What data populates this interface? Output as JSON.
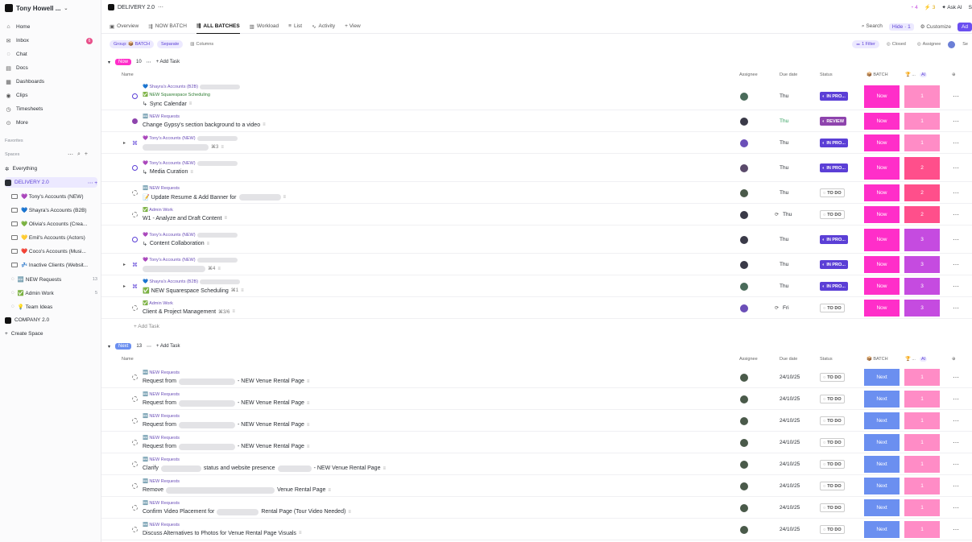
{
  "workspace": {
    "name": "Tony Howell ..."
  },
  "sidebar": {
    "nav": [
      {
        "label": "Home",
        "icon": "home-icon"
      },
      {
        "label": "Inbox",
        "icon": "inbox-icon",
        "badge": "6"
      },
      {
        "label": "Chat",
        "icon": "chat-icon"
      },
      {
        "label": "Docs",
        "icon": "docs-icon"
      },
      {
        "label": "Dashboards",
        "icon": "dashboards-icon"
      },
      {
        "label": "Clips",
        "icon": "clips-icon"
      },
      {
        "label": "Timesheets",
        "icon": "timesheets-icon"
      },
      {
        "label": "More",
        "icon": "more-icon"
      }
    ],
    "favorites_label": "Favorites",
    "spaces_label": "Spaces",
    "spaces": [
      {
        "label": "Everything",
        "icon": "everything-icon"
      },
      {
        "label": "DELIVERY 2.0",
        "icon": "space-icon",
        "active": true
      },
      {
        "label": "💜 Tony's Accounts (NEW)",
        "icon": "folder-icon"
      },
      {
        "label": "💙 Shayra's Accounts (B2B)",
        "icon": "folder-icon"
      },
      {
        "label": "💚 Olivia's Accounts (Crea...",
        "icon": "folder-icon"
      },
      {
        "label": "💛 Emil's Accounts (Actors)",
        "icon": "folder-icon"
      },
      {
        "label": "❤️ Coco's Accounts (Musi...",
        "icon": "folder-icon"
      },
      {
        "label": "💤 Inactive Clients (Websit...",
        "icon": "folder-icon"
      },
      {
        "label": "🆕 NEW Requests",
        "icon": "list-icon",
        "count": "13"
      },
      {
        "label": "✅ Admin Work",
        "icon": "list-icon",
        "count": "5"
      },
      {
        "label": "💡 Team Ideas",
        "icon": "list-icon"
      },
      {
        "label": "COMPANY 2.0",
        "icon": "space-icon"
      },
      {
        "label": "Create Space",
        "icon": "plus-icon"
      }
    ]
  },
  "topbar": {
    "title": "DELIVERY 2.0",
    "right": {
      "notif1": "4",
      "notif2": "3",
      "ask_ai": "Ask AI",
      "trailing": "S"
    }
  },
  "tabs": {
    "items": [
      "Overview",
      "NOW BATCH",
      "ALL BATCHES",
      "Workload",
      "List",
      "Activity",
      "+ View"
    ],
    "active": "ALL BATCHES",
    "right": {
      "search": "Search",
      "hide": "Hide · 1",
      "customize": "Customize",
      "add": "Ad"
    }
  },
  "filters": {
    "group": "Group: 📦 BATCH",
    "separate": "Separate",
    "columns": "Columns",
    "filter": "1 Filter",
    "closed": "Closed",
    "assignee": "Assignee",
    "trailing": "Se"
  },
  "columns": {
    "name": "Name",
    "assignee": "Assignee",
    "due": "Due date",
    "status": "Status",
    "batch": "📦 BATCH",
    "prio": "🏆 ...",
    "ai": "AI"
  },
  "groups": [
    {
      "label": "Now",
      "count": "10",
      "add": "+ Add Task",
      "rows": [
        {
          "list": "💙 Shayra's Accounts (B2B)",
          "sublist": "✅ NEW Squarespace Scheduling",
          "name": "Sync Calendar",
          "due": "Thu",
          "status": "IN PRO...",
          "batch": "Now",
          "prio": "1"
        },
        {
          "list": "🆕 NEW Requests",
          "name": "Change Gypsy's section background to a video",
          "due": "Thu",
          "status": "REVIEW",
          "batch": "Now",
          "prio": "1"
        },
        {
          "list": "💜 Tony's Accounts (NEW)",
          "name": "",
          "subcount": "3",
          "due": "Thu",
          "status": "IN PRO...",
          "batch": "Now",
          "prio": "1"
        },
        {
          "list": "💜 Tony's Accounts (NEW)",
          "name": "Media Curation",
          "due": "Thu",
          "status": "IN PRO...",
          "batch": "Now",
          "prio": "2"
        },
        {
          "list": "🆕 NEW Requests",
          "name": "📝 Update Resume & Add Banner for",
          "due": "Thu",
          "status": "TO DO",
          "batch": "Now",
          "prio": "2"
        },
        {
          "list": "✅ Admin Work",
          "name": "W1 - Analyze and Draft Content",
          "due": "Thu",
          "status": "TO DO",
          "batch": "Now",
          "prio": "2"
        },
        {
          "list": "💜 Tony's Accounts (NEW)",
          "name": "Content Collaboration",
          "due": "Thu",
          "status": "IN PRO...",
          "batch": "Now",
          "prio": "3"
        },
        {
          "list": "💜 Tony's Accounts (NEW)",
          "name": "",
          "subcount": "4",
          "due": "Thu",
          "status": "IN PRO...",
          "batch": "Now",
          "prio": "3"
        },
        {
          "list": "💙 Shayra's Accounts (B2B)",
          "name": "✅ NEW Squarespace Scheduling",
          "subcount": "1",
          "due": "Thu",
          "status": "IN PRO...",
          "batch": "Now",
          "prio": "3"
        },
        {
          "list": "✅ Admin Work",
          "name": "Client & Project Management",
          "subcount": "3/6",
          "due": "Fri",
          "status": "TO DO",
          "batch": "Now",
          "prio": "3"
        }
      ],
      "add_task": "Add Task"
    },
    {
      "label": "Next",
      "count": "13",
      "add": "+ Add Task",
      "rows": [
        {
          "list": "🆕 NEW Requests",
          "name": "Request from",
          "name2": "- NEW Venue Rental Page",
          "due": "24/10/25",
          "status": "TO DO",
          "batch": "Next",
          "prio": "1"
        },
        {
          "list": "🆕 NEW Requests",
          "name": "Request from",
          "name2": "- NEW Venue Rental Page",
          "due": "24/10/25",
          "status": "TO DO",
          "batch": "Next",
          "prio": "1"
        },
        {
          "list": "🆕 NEW Requests",
          "name": "Request from",
          "name2": "- NEW Venue Rental Page",
          "due": "24/10/25",
          "status": "TO DO",
          "batch": "Next",
          "prio": "1"
        },
        {
          "list": "🆕 NEW Requests",
          "name": "Request from",
          "name2": "- NEW Venue Rental Page",
          "due": "24/10/25",
          "status": "TO DO",
          "batch": "Next",
          "prio": "1"
        },
        {
          "list": "🆕 NEW Requests",
          "name": "Clarify",
          "name2": "status and website presence",
          "name3": "- NEW Venue Rental Page",
          "due": "24/10/25",
          "status": "TO DO",
          "batch": "Next",
          "prio": "1"
        },
        {
          "list": "🆕 NEW Requests",
          "name": "Remove",
          "name2": "Venue Rental Page",
          "due": "24/10/25",
          "status": "TO DO",
          "batch": "Next",
          "prio": "1"
        },
        {
          "list": "🆕 NEW Requests",
          "name": "Confirm Video Placement for",
          "name2": "Rental Page (Tour Video Needed)",
          "due": "24/10/25",
          "status": "TO DO",
          "batch": "Next",
          "prio": "1"
        },
        {
          "list": "🆕 NEW Requests",
          "name": "Discuss Alternatives to Photos for Venue Rental Page Visuals",
          "due": "24/10/25",
          "status": "TO DO",
          "batch": "Next",
          "prio": "1"
        }
      ]
    }
  ],
  "colors": {
    "now": "#ff2ec9",
    "next": "#6b8ff0",
    "p1": "#ff8cc6",
    "p2": "#ff4f8b",
    "p3": "#c54be0",
    "accent": "#6b4ff0"
  }
}
